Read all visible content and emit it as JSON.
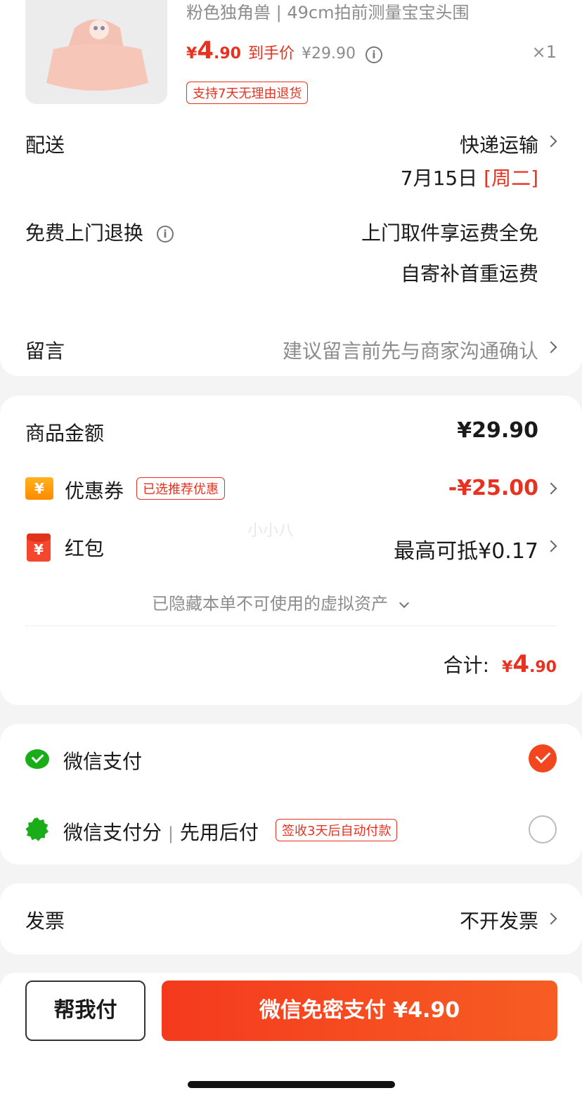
{
  "product": {
    "spec": "粉色独角兽 | 49cm拍前测量宝宝头围",
    "price_symbol": "¥",
    "price_int": "4",
    "price_dec": ".90",
    "price_label": "到手价",
    "original_price": "¥29.90",
    "quantity": "×1",
    "return_tag": "支持7天无理由退货"
  },
  "delivery": {
    "label": "配送",
    "method": "快递运输",
    "date": "7月15日",
    "weekday": "[周二]"
  },
  "free_return": {
    "label": "免费上门退换",
    "line1": "上门取件享运费全免",
    "line2": "自寄补首重运费"
  },
  "message": {
    "label": "留言",
    "placeholder": "建议留言前先与商家沟通确认"
  },
  "amount": {
    "goods_label": "商品金额",
    "goods_value": "¥29.90",
    "coupon_label": "优惠券",
    "coupon_tag": "已选推荐优惠",
    "coupon_value": "-¥25.00",
    "redpack_label": "红包",
    "redpack_value": "最高可抵¥0.17",
    "hidden_assets": "已隐藏本单不可使用的虚拟资产",
    "total_label": "合计:",
    "total_symbol": "¥",
    "total_int": "4",
    "total_dec": ".90",
    "watermark": "小小八"
  },
  "payment": {
    "wechat_label": "微信支付",
    "wechat_score_label": "微信支付分",
    "wechat_score_sep": "|",
    "wechat_score_sub": "先用后付",
    "wechat_score_tag": "签收3天后自动付款"
  },
  "invoice": {
    "label": "发票",
    "value": "不开发票"
  },
  "footer": {
    "help_pay": "帮我付",
    "pay_button": "微信免密支付  ¥4.90"
  },
  "colors": {
    "accent": "#e8311f",
    "wechat_green": "#1aad19"
  }
}
